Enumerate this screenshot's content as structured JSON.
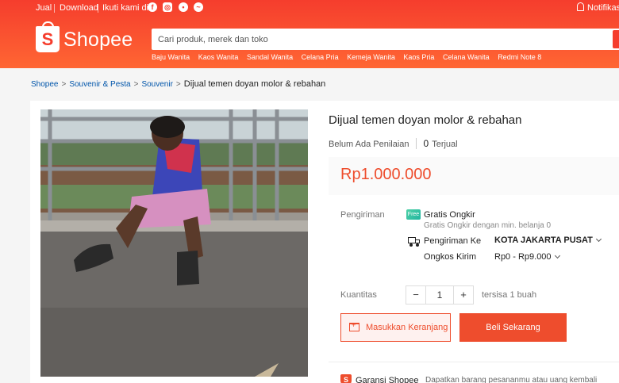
{
  "topbar": {
    "sell": "Jual",
    "download": "Download",
    "follow": "Ikuti kami di",
    "social_icons": [
      "facebook-icon",
      "instagram-icon",
      "line-icon",
      "twitter-icon"
    ],
    "notifications": "Notifikasi"
  },
  "brand": {
    "logo_glyph": "S",
    "name": "Shopee",
    "color": "#ee4d2d"
  },
  "search": {
    "placeholder": "Cari produk, merek dan toko",
    "suggestions": [
      "Baju Wanita",
      "Kaos Wanita",
      "Sandal Wanita",
      "Celana Pria",
      "Kemeja Wanita",
      "Kaos Pria",
      "Celana Wanita",
      "Redmi Note 8"
    ]
  },
  "breadcrumb": [
    "Shopee",
    "Souvenir & Pesta",
    "Souvenir",
    "Dijual temen doyan molor & rebahan"
  ],
  "product": {
    "title": "Dijual temen doyan molor & rebahan",
    "rating_text": "Belum Ada Penilaian",
    "sold_count": "0",
    "sold_label": "Terjual",
    "price": "Rp1.000.000",
    "image_alt": "Photo of a boy sitting on a curb with his head in his hands"
  },
  "shipping": {
    "label": "Pengiriman",
    "free_badge": "Free",
    "free_title": "Gratis Ongkir",
    "free_sub": "Gratis Ongkir dengan min. belanja 0",
    "to_label": "Pengiriman Ke",
    "to_value": "KOTA JAKARTA PUSAT",
    "cost_label": "Ongkos Kirim",
    "cost_value": "Rp0 - Rp9.000"
  },
  "quantity": {
    "label": "Kuantitas",
    "minus": "−",
    "value": "1",
    "plus": "+",
    "stock": "tersisa 1 buah"
  },
  "actions": {
    "add_to_cart": "Masukkan Keranjang",
    "buy_now": "Beli Sekarang"
  },
  "guarantee": {
    "title": "Garansi Shopee",
    "subtitle": "Dapatkan barang pesananmu atau uang kembali"
  }
}
